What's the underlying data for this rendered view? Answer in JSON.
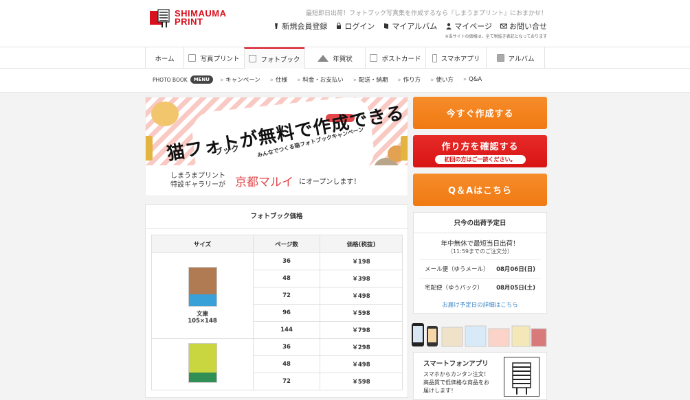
{
  "brand": {
    "line1": "SHIMAUMA",
    "line2": "PRINT"
  },
  "tagline": "最短即日出荷！フォトブック写真集を作成するなら『しまうまプリント』におまかせ！",
  "utility_links": [
    {
      "label": "新規会員登録",
      "icon": "user-icon"
    },
    {
      "label": "ログイン",
      "icon": "lock-icon"
    },
    {
      "label": "マイアルバム",
      "icon": "album-icon"
    },
    {
      "label": "マイページ",
      "icon": "person-icon"
    },
    {
      "label": "お問い合せ",
      "icon": "mail-icon"
    }
  ],
  "tax_note": "※当サイトの価格は、全て税抜き表記となっております",
  "global_nav": [
    {
      "label": "ホーム",
      "icon": ""
    },
    {
      "label": "写真プリント",
      "icon": "photo-icon"
    },
    {
      "label": "フォトブック",
      "icon": "book-icon",
      "active": true
    },
    {
      "label": "年賀状",
      "icon": "mountain-icon"
    },
    {
      "label": "ポストカード",
      "icon": "postcard-icon"
    },
    {
      "label": "スマホアプリ",
      "icon": "phone-icon"
    },
    {
      "label": "アルバム",
      "icon": "album-icon"
    }
  ],
  "subnav": {
    "label": "PHOTO BOOK",
    "menu": "MENU",
    "items": [
      "キャンペーン",
      "仕様",
      "料金・お支払い",
      "配送・納期",
      "作り方",
      "使い方",
      "Q&A"
    ]
  },
  "banner": {
    "title": "猫フォトが無料で作成できる",
    "sub": "ブック",
    "campaign": "みんなでつくる猫フォトブックキャンペーン",
    "gallery": "しまうまプリント",
    "gallery2": "特設ギャラリーが",
    "place": "京都マルイ",
    "open": "にオープンします！"
  },
  "price": {
    "title": "フォトブック価格",
    "headers": [
      "サイズ",
      "ページ数",
      "価格(税抜)"
    ],
    "groups": [
      {
        "size_name": "文庫",
        "size_dim": "105×148",
        "rows": [
          {
            "pages": "36",
            "price": "￥198"
          },
          {
            "pages": "48",
            "price": "￥398"
          },
          {
            "pages": "72",
            "price": "￥498"
          },
          {
            "pages": "96",
            "price": "￥598"
          },
          {
            "pages": "144",
            "price": "￥798"
          }
        ]
      },
      {
        "size_name": "",
        "size_dim": "",
        "rows": [
          {
            "pages": "36",
            "price": "￥298"
          },
          {
            "pages": "48",
            "price": "￥498"
          },
          {
            "pages": "72",
            "price": "￥598"
          }
        ]
      }
    ]
  },
  "side": {
    "cta_create": "今すぐ作成する",
    "cta_howto": "作り方を確認する",
    "cta_howto_note": "初回の方はご一読ください。",
    "cta_qa": "Q＆Aはこちら",
    "ship_title": "只今の出荷予定日",
    "ship_lead": "年中無休で最短当日出荷！",
    "ship_time": "（11:59までのご注文分）",
    "ship_rows": [
      {
        "method": "メール便（ゆうメール）",
        "date": "08月06日(日)"
      },
      {
        "method": "宅配便（ゆうパック）",
        "date": "08月05日(土)"
      }
    ],
    "ship_link": "お届け予定日の詳細はこちら",
    "app_title": "スマートフォンアプリ",
    "app_desc": [
      "スマホからカンタン注文！",
      "高品質で低価格な商品をお",
      "届けします！"
    ]
  },
  "colors": {
    "brand_red": "#d9101d",
    "cta_orange": "#f07a12",
    "cta_red": "#d81414",
    "link_blue": "#3f86c7"
  }
}
